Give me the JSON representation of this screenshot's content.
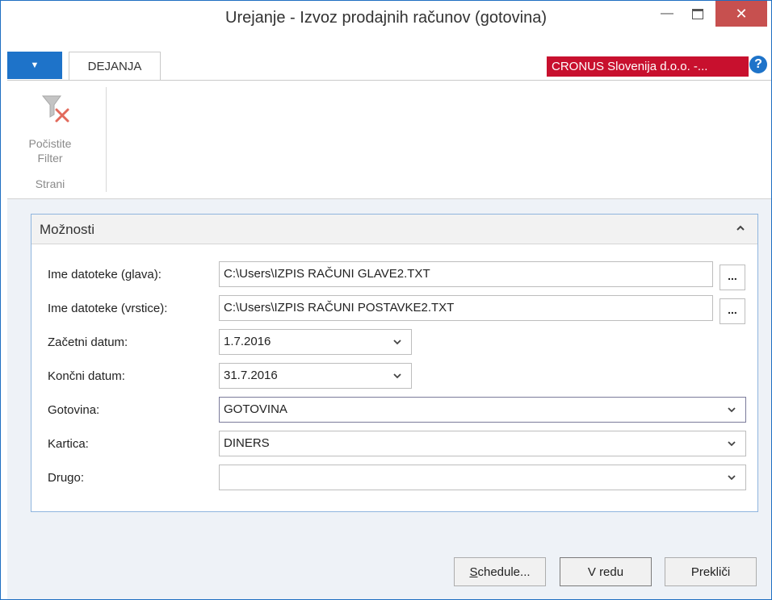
{
  "window": {
    "title": "Urejanje - Izvoz prodajnih računov (gotovina)"
  },
  "ribbon": {
    "tab_label": "DEJANJA",
    "company": "CRONUS Slovenija d.o.o. -...",
    "help": "?",
    "clear_filter_line1": "Počistite",
    "clear_filter_line2": "Filter",
    "group_label": "Strani"
  },
  "options": {
    "title": "Možnosti",
    "header_file_label": "Ime datoteke (glava):",
    "header_file_value": "C:\\Users\\IZPIS RAČUNI GLAVE2.TXT",
    "lines_file_label": "Ime datoteke (vrstice):",
    "lines_file_value": "C:\\Users\\IZPIS RAČUNI POSTAVKE2.TXT",
    "ellipsis": "...",
    "start_date_label": "Začetni datum:",
    "start_date_value": "1.7.2016",
    "end_date_label": "Končni datum:",
    "end_date_value": "31.7.2016",
    "cash_label": "Gotovina:",
    "cash_value": "GOTOVINA",
    "card_label": "Kartica:",
    "card_value": "DINERS",
    "other_label": "Drugo:",
    "other_value": ""
  },
  "buttons": {
    "schedule_accel": "S",
    "schedule_rest": "chedule...",
    "ok": "V redu",
    "cancel": "Prekliči"
  },
  "colors": {
    "accent_blue": "#1e73c9",
    "company_red": "#c8102e",
    "close_red": "#c7504f"
  }
}
